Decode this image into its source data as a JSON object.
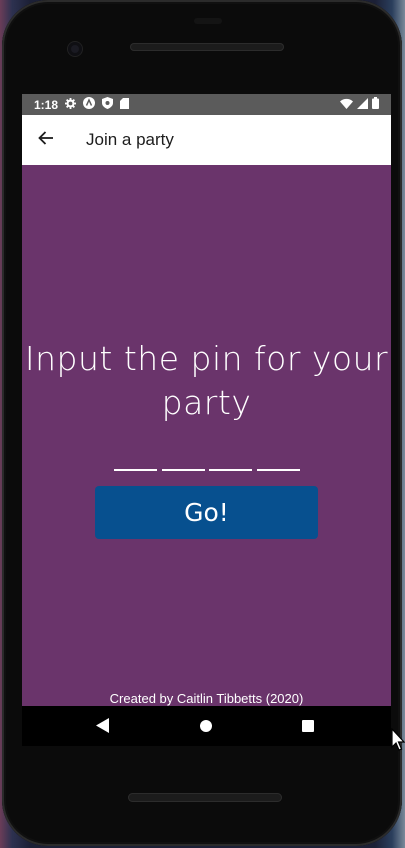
{
  "status_bar": {
    "time": "1:18",
    "left_icons": [
      "settings-icon",
      "launcher-icon",
      "shield-icon",
      "sd-card-icon"
    ],
    "right_icons": [
      "wifi-icon",
      "signal-icon",
      "battery-icon"
    ]
  },
  "app_bar": {
    "back_icon": "arrow-left-icon",
    "title": "Join a party"
  },
  "main": {
    "headline": "Input the pin for your party",
    "pin_slots": [
      "",
      "",
      "",
      ""
    ],
    "go_button_label": "Go!",
    "credit": "Created by Caitlin Tibbetts (2020)"
  },
  "colors": {
    "background": "#6a346b",
    "button": "#07508f",
    "app_bar": "#ffffff",
    "status_bar": "#5b5b5b"
  },
  "nav_bar": {
    "icons": [
      "nav-back-icon",
      "nav-home-icon",
      "nav-recents-icon"
    ]
  }
}
